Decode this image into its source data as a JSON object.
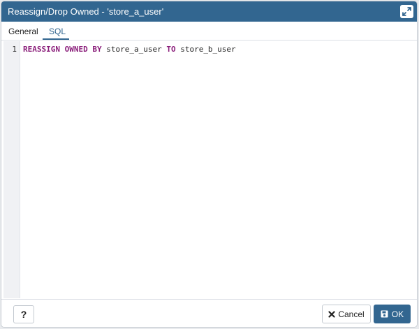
{
  "dialog": {
    "title": "Reassign/Drop Owned - 'store_a_user'",
    "tabs": [
      {
        "label": "General",
        "active": false
      },
      {
        "label": "SQL",
        "active": true
      }
    ]
  },
  "editor": {
    "lines": [
      {
        "number": "1",
        "tokens": [
          {
            "text": "REASSIGN",
            "type": "keyword"
          },
          {
            "text": " ",
            "type": "plain"
          },
          {
            "text": "OWNED",
            "type": "keyword"
          },
          {
            "text": " ",
            "type": "plain"
          },
          {
            "text": "BY",
            "type": "keyword"
          },
          {
            "text": " store_a_user ",
            "type": "plain"
          },
          {
            "text": "TO",
            "type": "keyword"
          },
          {
            "text": " store_b_user",
            "type": "plain"
          }
        ]
      }
    ]
  },
  "footer": {
    "help_label": "?",
    "cancel_label": "Cancel",
    "ok_label": "OK"
  },
  "icons": {
    "maximize": "expand-icon",
    "cancel": "close-icon",
    "ok": "save-icon"
  },
  "colors": {
    "accent": "#326690",
    "keyword": "#8b1f7b"
  }
}
